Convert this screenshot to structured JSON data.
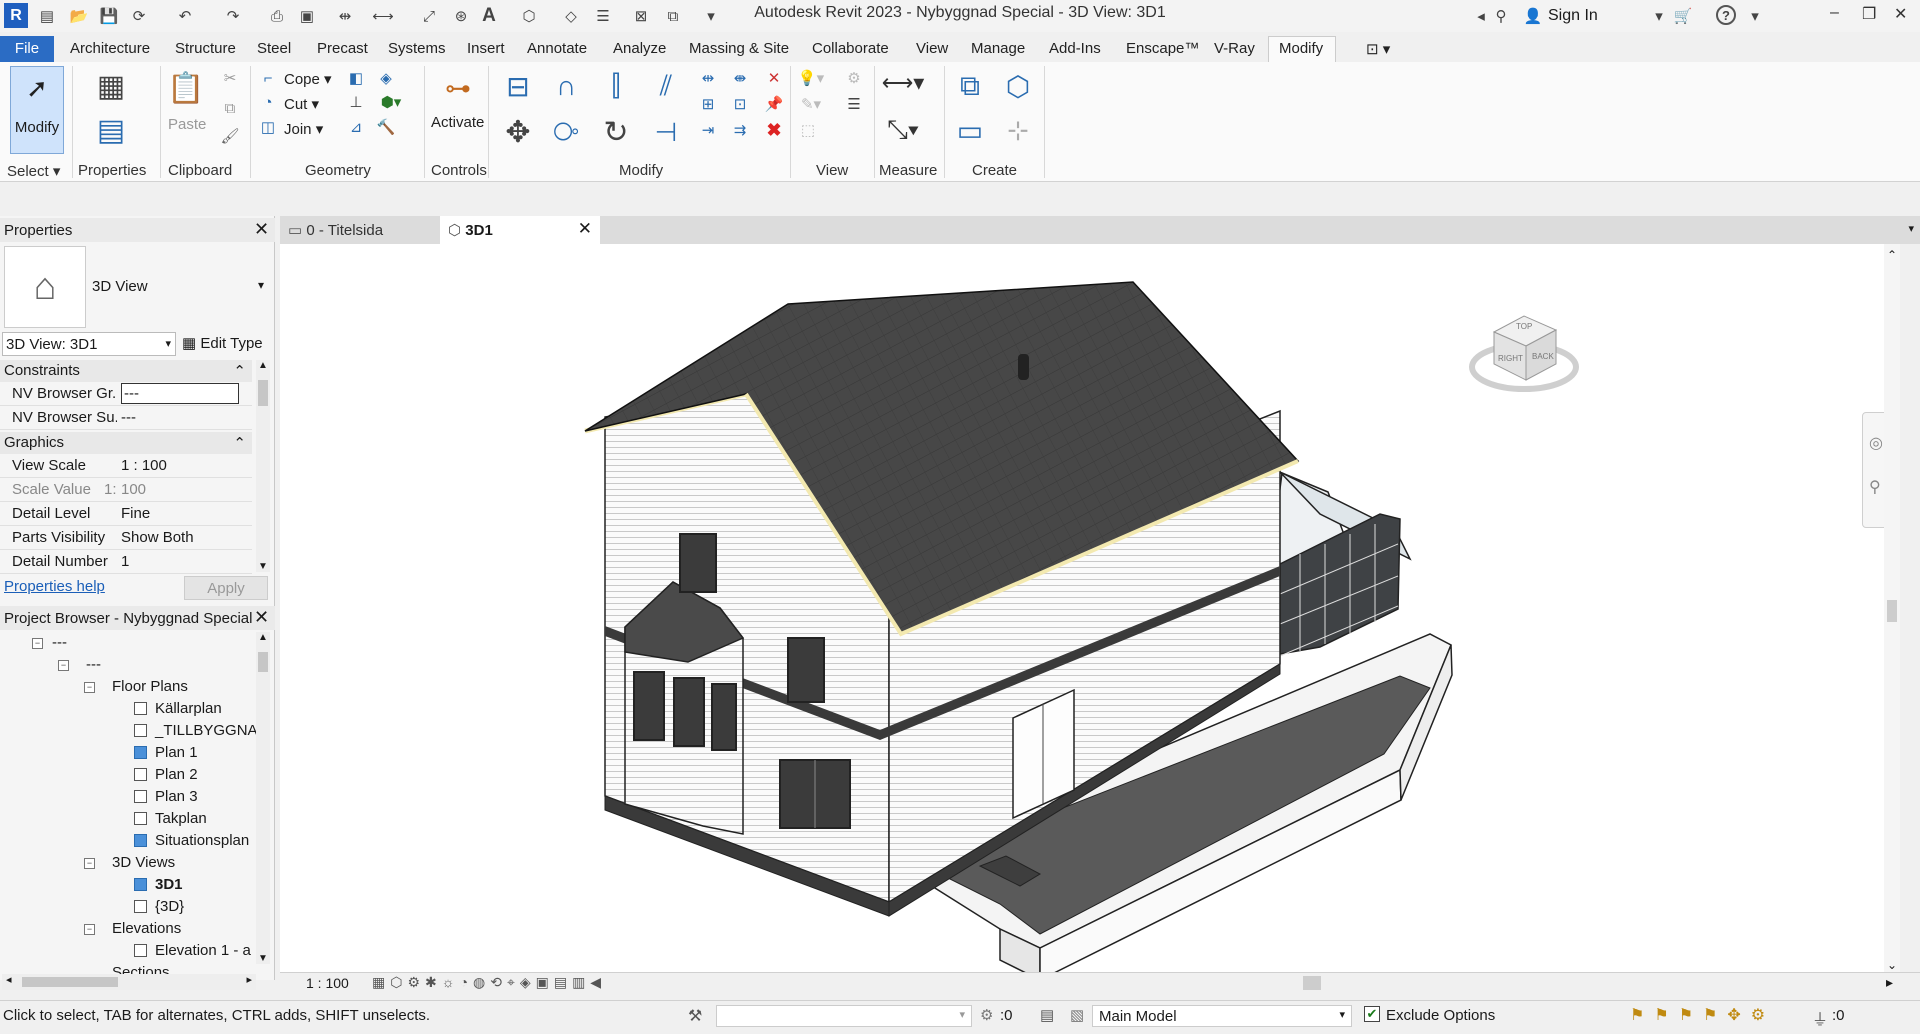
{
  "title": "Autodesk Revit 2023 - Nybyggnad Special - 3D View: 3D1",
  "titlebar": {
    "sign_in": "Sign In",
    "minimize": "–",
    "restore": "❐",
    "close": "✕"
  },
  "menu": {
    "file": "File",
    "tabs": [
      "Architecture",
      "Structure",
      "Steel",
      "Precast",
      "Systems",
      "Insert",
      "Annotate",
      "Analyze",
      "Massing & Site",
      "Collaborate",
      "View",
      "Manage",
      "Add-Ins",
      "Enscape™",
      "V-Ray",
      "Modify"
    ],
    "active_tab": "Modify"
  },
  "ribbon": {
    "modify_label": "Modify",
    "paste_label": "Paste",
    "cope_label": "Cope",
    "cut_label": "Cut",
    "join_label": "Join",
    "activate_label": "Activate",
    "panels": {
      "select": "Select",
      "properties": "Properties",
      "clipboard": "Clipboard",
      "geometry": "Geometry",
      "controls": "Controls",
      "modify": "Modify",
      "view": "View",
      "measure": "Measure",
      "create": "Create"
    }
  },
  "properties_panel": {
    "title": "Properties",
    "type_name": "3D View",
    "instance_selector": "3D View: 3D1",
    "edit_type": "Edit Type",
    "categories": {
      "constraints": "Constraints",
      "graphics": "Graphics"
    },
    "constraints_rows": [
      {
        "name": "NV Browser Gr...",
        "value": "---"
      },
      {
        "name": "NV Browser Su...",
        "value": "---"
      }
    ],
    "graphics_rows": [
      {
        "name": "View Scale",
        "value": "1 : 100"
      },
      {
        "name": "Scale Value",
        "prefix": "1:",
        "value": "100"
      },
      {
        "name": "Detail Level",
        "value": "Fine"
      },
      {
        "name": "Parts Visibility",
        "value": "Show Both"
      },
      {
        "name": "Detail Number",
        "value": "1"
      }
    ],
    "help_link": "Properties help",
    "apply": "Apply"
  },
  "project_browser": {
    "title": "Project Browser - Nybyggnad Special",
    "root_1": "---",
    "root_2": "---",
    "floor_plans": "Floor Plans",
    "floor_plan_items": [
      "Källarplan",
      "_TILLBYGGNAD",
      "Plan 1",
      "Plan 2",
      "Plan 3",
      "Takplan",
      "Situationsplan"
    ],
    "views_3d": "3D Views",
    "views_3d_items": [
      "3D1",
      "{3D}"
    ],
    "elevations": "Elevations",
    "elevation_items": [
      "Elevation 1 - a"
    ],
    "sections": "Sections"
  },
  "doc_tabs": [
    {
      "label": "0 - Titelsida",
      "active": false
    },
    {
      "label": "3D1",
      "active": true
    }
  ],
  "viewcube": {
    "top": "TOP",
    "right": "RIGHT",
    "back": "BACK"
  },
  "view_control_bar": {
    "scale": "1 : 100"
  },
  "status_bar": {
    "hint": "Click to select, TAB for alternates, CTRL adds, SHIFT unselects.",
    "selection_count": ":0",
    "workset": "Main Model",
    "exclude_options": "Exclude Options",
    "filter_count": ":0"
  }
}
